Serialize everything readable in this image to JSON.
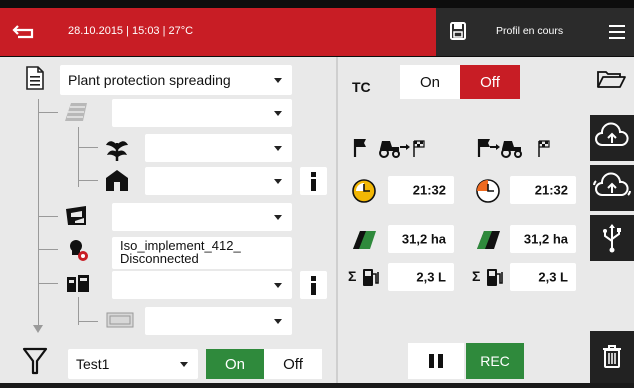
{
  "header": {
    "status_text": "28.10.2015 | 15:03 | 27°C",
    "profile_label": "Profil en cours"
  },
  "left": {
    "job_type": "Plant protection spreading",
    "implement": {
      "name_line1": "Iso_implement_412_",
      "name_line2": "Disconnected"
    },
    "filter": {
      "value": "Test1",
      "on_label": "On",
      "off_label": "Off",
      "state": "on"
    }
  },
  "right": {
    "tc": {
      "label": "TC",
      "on_label": "On",
      "off_label": "Off",
      "state": "off"
    },
    "col1": {
      "time": "21:32",
      "area": "31,2 ha",
      "fuel": "2,3 L"
    },
    "col2": {
      "time": "21:32",
      "area": "31,2 ha",
      "fuel": "2,3 L"
    },
    "sigma_symbol": "Σ",
    "rec_label": "REC"
  },
  "colors": {
    "accent_red": "#c81d25",
    "active_green": "#2f8a3c",
    "clock_yellow": "#f2b705",
    "clock_orange": "#ee6a1f"
  },
  "icons": {
    "back": "back-arrow-icon",
    "save": "save-icon",
    "menu": "hamburger-menu-icon",
    "folder": "folder-icon",
    "cloud_up": "cloud-upload-icon",
    "cloud_sync": "cloud-sync-icon",
    "usb": "usb-icon",
    "trash": "trash-icon",
    "filter": "filter-icon",
    "pause": "pause-icon"
  }
}
